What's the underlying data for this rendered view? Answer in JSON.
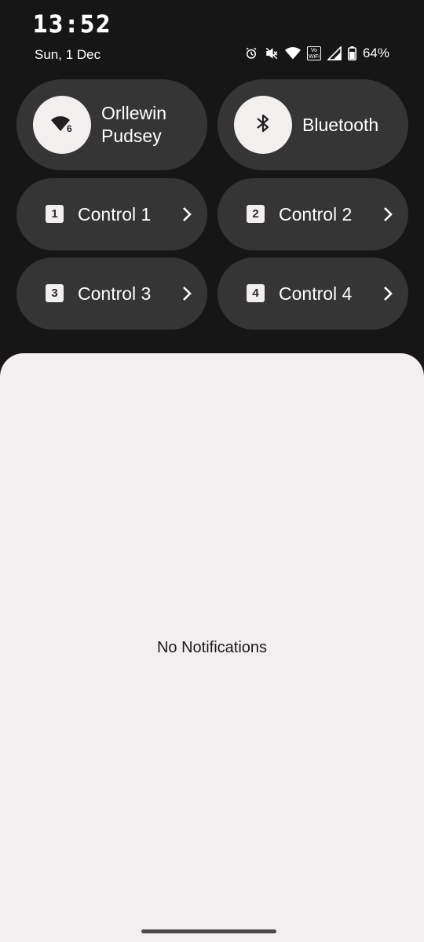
{
  "status": {
    "time": "13:52",
    "date": "Sun, 1 Dec",
    "battery": "64%",
    "vowifi_line1": "Vo",
    "vowifi_line2": "WiFi",
    "icons": [
      "alarm-icon",
      "mute-icon",
      "wifi-icon",
      "vowifi-icon",
      "signal-icon",
      "battery-icon"
    ]
  },
  "tiles": {
    "wifi": {
      "label_line1": "Orllewin",
      "label_line2": "Pudsey",
      "badge": "6",
      "icon": "wifi-6-icon"
    },
    "bluetooth": {
      "label": "Bluetooth",
      "icon": "bluetooth-icon"
    },
    "controls": [
      {
        "number": "1",
        "label": "Control 1"
      },
      {
        "number": "2",
        "label": "Control 2"
      },
      {
        "number": "3",
        "label": "Control 3"
      },
      {
        "number": "4",
        "label": "Control 4"
      }
    ]
  },
  "notifications": {
    "empty_text": "No Notifications"
  },
  "colors": {
    "background": "#161616",
    "tile": "#353535",
    "tile_icon_bg": "#f2efef",
    "shade": "#f3eff0"
  }
}
